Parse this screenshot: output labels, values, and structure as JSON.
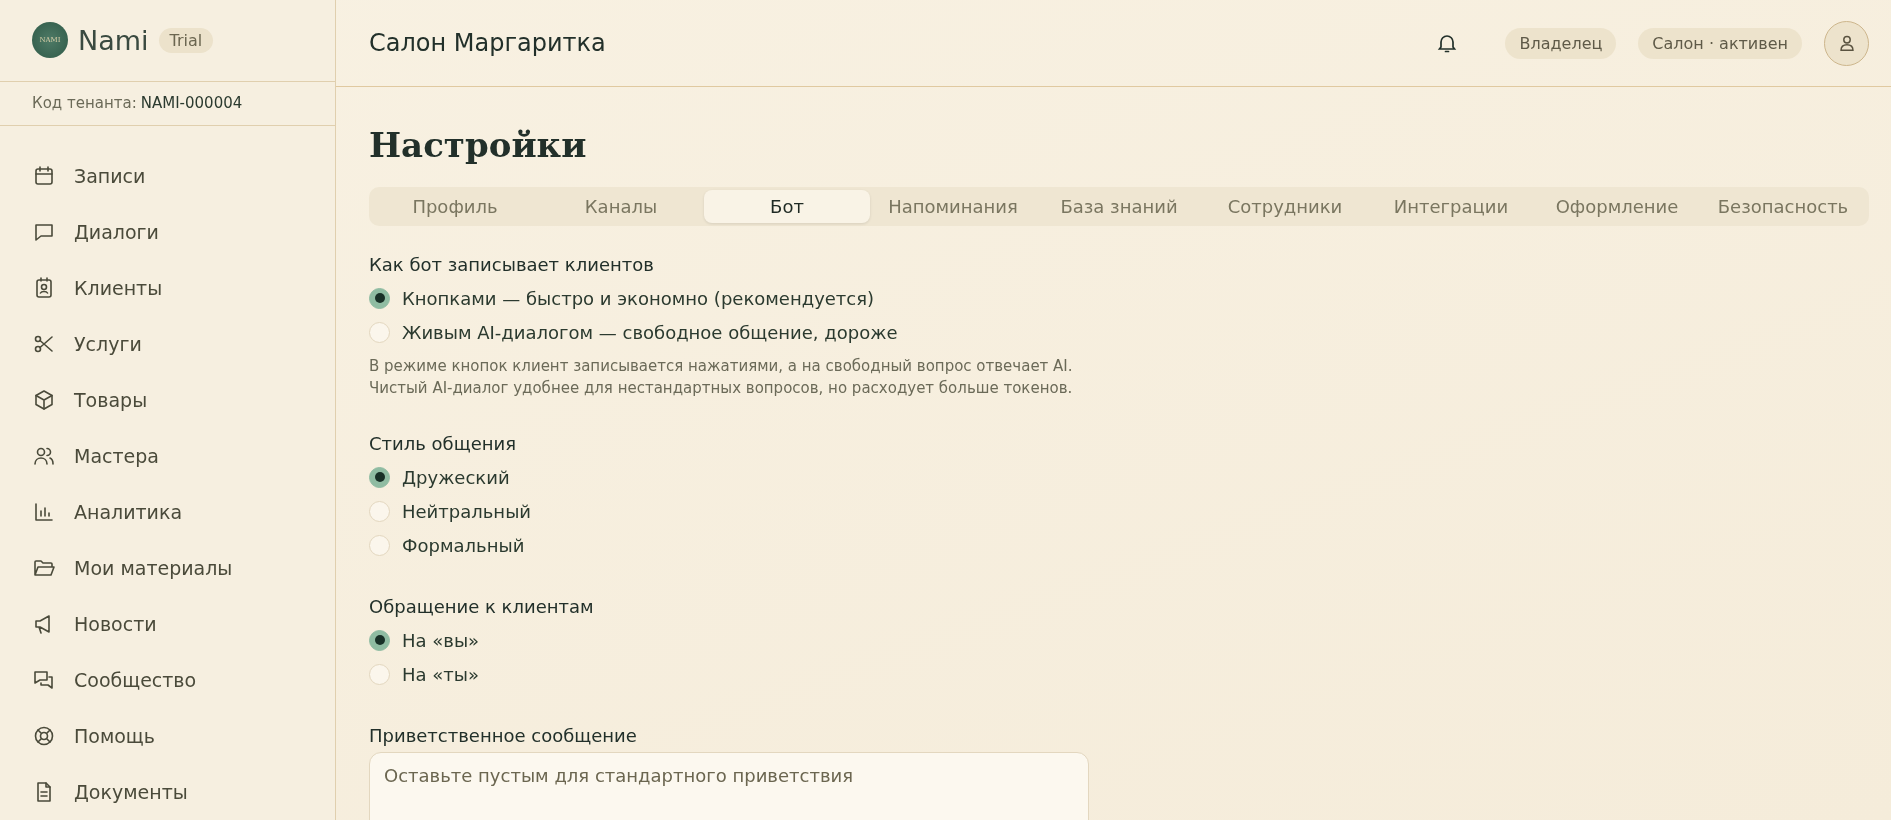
{
  "brand": {
    "name": "Nami",
    "logo_text": "NAMI",
    "badge": "Trial"
  },
  "tenant": {
    "label": "Код тенанта:",
    "code": "NAMI-000004"
  },
  "sidebar": {
    "items": [
      {
        "label": "Записи",
        "selected": false
      },
      {
        "label": "Диалоги",
        "selected": false
      },
      {
        "label": "Клиенты",
        "selected": false
      },
      {
        "label": "Услуги",
        "selected": false
      },
      {
        "label": "Товары",
        "selected": false
      },
      {
        "label": "Мастера",
        "selected": false
      },
      {
        "label": "Аналитика",
        "selected": false
      },
      {
        "label": "Мои материалы",
        "selected": false
      },
      {
        "label": "Новости",
        "selected": false
      },
      {
        "label": "Сообщество",
        "selected": false
      },
      {
        "label": "Помощь",
        "selected": false
      },
      {
        "label": "Документы",
        "selected": false
      }
    ]
  },
  "header": {
    "title": "Салон Маргаритка",
    "role": "Владелец",
    "status": "Салон · активен"
  },
  "page_title": "Настройки",
  "tabs": [
    {
      "label": "Профиль",
      "selected": false
    },
    {
      "label": "Каналы",
      "selected": false
    },
    {
      "label": "Бот",
      "selected": true
    },
    {
      "label": "Напоминания",
      "selected": false
    },
    {
      "label": "База знаний",
      "selected": false
    },
    {
      "label": "Сотрудники",
      "selected": false
    },
    {
      "label": "Интеграции",
      "selected": false
    },
    {
      "label": "Оформление",
      "selected": false
    },
    {
      "label": "Безопасность",
      "selected": false
    }
  ],
  "groups": [
    {
      "title": "Как бот записывает клиентов",
      "options": [
        {
          "label": "Кнопками — быстро и экономно (рекомендуется)",
          "selected": true
        },
        {
          "label": "Живым AI-диалогом — свободное общение, дороже",
          "selected": false
        }
      ],
      "hint": [
        "В режиме кнопок клиент записывается нажатиями, а на свободный вопрос отвечает AI.",
        "Чистый AI-диалог удобнее для нестандартных вопросов, но расходует больше токенов."
      ]
    },
    {
      "title": "Стиль общения",
      "options": [
        {
          "label": "Дружеский",
          "selected": true
        },
        {
          "label": "Нейтральный",
          "selected": false
        },
        {
          "label": "Формальный",
          "selected": false
        }
      ]
    },
    {
      "title": "Обращение к клиентам",
      "options": [
        {
          "label": "На «вы»",
          "selected": true
        },
        {
          "label": "На «ты»",
          "selected": false
        }
      ]
    }
  ],
  "greeting": {
    "label": "Приветственное сообщение",
    "placeholder": "Оставьте пустым для стандартного приветствия"
  }
}
